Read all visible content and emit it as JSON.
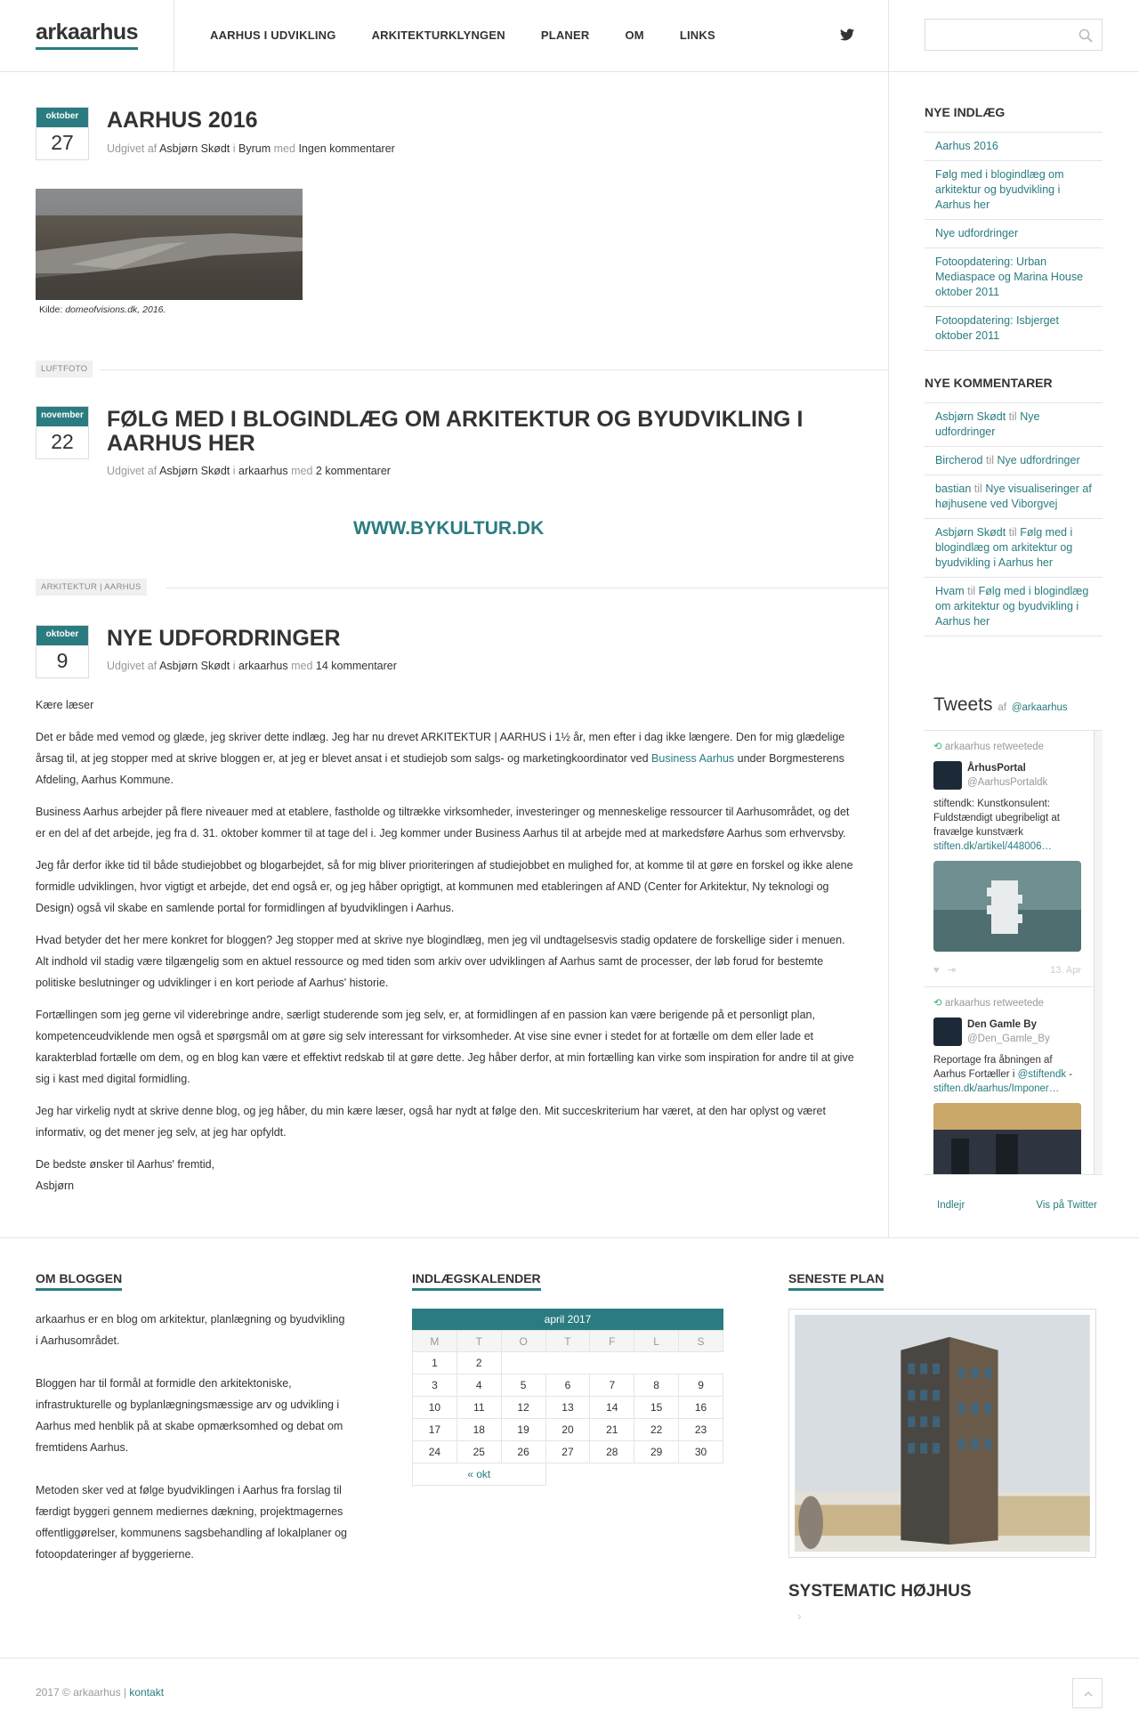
{
  "header": {
    "logo": "arkaarhus",
    "nav": [
      "AARHUS I UDVIKLING",
      "ARKITEKTURKLYNGEN",
      "PLANER",
      "OM",
      "LINKS"
    ],
    "search_placeholder": ""
  },
  "posts": [
    {
      "month": "oktober",
      "day": "27",
      "title": "AARHUS 2016",
      "meta_prefix": "Udgivet af",
      "author": "Asbjørn Skødt",
      "in": "i",
      "category": "Byrum",
      "with": "med",
      "comments": "Ingen kommentarer",
      "caption_prefix": "Kilde: ",
      "caption_source": "domeofvisions.dk, 2016."
    },
    {
      "month": "november",
      "day": "22",
      "title": "FØLG MED I BLOGINDLÆG OM ARKITEKTUR OG BYUDVIKLING I AARHUS HER",
      "meta_prefix": "Udgivet af",
      "author": "Asbjørn Skødt",
      "in": "i",
      "category": "arkaarhus",
      "with": "med",
      "comments": "2 kommentarer",
      "link": "WWW.BYKULTUR.DK"
    },
    {
      "month": "oktober",
      "day": "9",
      "title": "NYE UDFORDRINGER",
      "meta_prefix": "Udgivet af",
      "author": "Asbjørn Skødt",
      "in": "i",
      "category": "arkaarhus",
      "with": "med",
      "comments": "14 kommentarer"
    }
  ],
  "tags": [
    "LUFTFOTO",
    "ARKITEKTUR | AARHUS"
  ],
  "body": {
    "p1": "Kære læser",
    "p2a": "Det er både med vemod og glæde, jeg skriver dette indlæg. Jeg har nu drevet ARKITEKTUR | AARHUS i 1½ år, men efter i dag ikke længere. Den for mig glædelige årsag til, at jeg stopper med at skrive bloggen er, at jeg er blevet ansat i et studiejob som salgs- og marketingkoordinator ved ",
    "p2link": "Business Aarhus",
    "p2b": " under Borgmesterens Afdeling, Aarhus Kommune.",
    "p3": "Business Aarhus arbejder på flere niveauer med at etablere, fastholde og tiltrække virksomheder, investeringer og menneskelige ressourcer til Aarhusområdet, og det er en del af det arbejde, jeg fra d. 31. oktober kommer til at tage del i. Jeg kommer under Business Aarhus til at arbejde med at markedsføre Aarhus som erhvervsby.",
    "p4": "Jeg får derfor ikke tid til både studiejobbet og blogarbejdet, så for mig bliver prioriteringen af studiejobbet en mulighed for, at komme til at gøre en forskel og ikke alene formidle udviklingen, hvor vigtigt et arbejde, det end også er, og jeg håber oprigtigt, at kommunen med etableringen af AND (Center for Arkitektur, Ny teknologi og Design) også vil skabe en samlende portal for formidlingen af byudviklingen i Aarhus.",
    "p5": "Hvad betyder det her mere konkret for bloggen? Jeg stopper med at skrive nye blogindlæg, men jeg vil undtagelsesvis stadig opdatere de forskellige sider i menuen. Alt indhold vil stadig være tilgængelig som en aktuel ressource og med tiden som arkiv over udviklingen af Aarhus samt de processer, der løb forud for bestemte politiske beslutninger og udviklinger i en kort periode af Aarhus' historie.",
    "p6": "Fortællingen som jeg gerne vil viderebringe andre, særligt studerende som jeg selv, er, at formidlingen af en passion kan være berigende på et personligt plan, kompetenceudviklende men også et spørgsmål om at gøre sig selv interessant for virksomheder. At vise sine evner i stedet for at fortælle om dem eller lade et karakterblad fortælle om dem, og en blog kan være et effektivt redskab til at gøre dette. Jeg håber derfor, at min fortælling kan virke som inspiration for andre til at give sig i kast med digital formidling.",
    "p7": "Jeg har virkelig nydt at skrive denne blog, og jeg håber, du min kære læser, også har nydt at følge den. Mit succeskriterium har været, at den har oplyst og været informativ, og det mener jeg selv, at jeg har opfyldt.",
    "p8a": "De bedste ønsker til Aarhus' fremtid,",
    "p8b": "Asbjørn"
  },
  "sidebar": {
    "recent_title": "NYE INDLÆG",
    "recent": [
      "Aarhus 2016",
      "Følg med i blogindlæg om arkitektur og byudvikling i Aarhus her",
      "Nye udfordringer",
      "Fotoopdatering: Urban Mediaspace og Marina House oktober 2011",
      "Fotoopdatering: Isbjerget oktober 2011"
    ],
    "comments_title": "NYE KOMMENTARER",
    "til": "til",
    "comments": [
      {
        "who": "Asbjørn Skødt",
        "post": "Nye udfordringer"
      },
      {
        "who": "Bircherod",
        "post": "Nye udfordringer"
      },
      {
        "who": "bastian",
        "post": "Nye visualiseringer af højhusene ved Viborgvej"
      },
      {
        "who": "Asbjørn Skødt",
        "post": "Følg med i blogindlæg om arkitektur og byudvikling i Aarhus her"
      },
      {
        "who": "Hvam",
        "post": "Følg med i blogindlæg om arkitektur og byudvikling i Aarhus her"
      }
    ]
  },
  "tweets": {
    "title": "Tweets",
    "by": "af",
    "handle": "@arkaarhus",
    "items": [
      {
        "rt": "arkaarhus retweetede",
        "name": "ÅrhusPortal",
        "handle": "@AarhusPortaldk",
        "text": "stiftendk: Kunstkonsulent: Fuldstændigt ubegribeligt at fravælge kunstværk",
        "link": "stiften.dk/artikel/448006…",
        "date": "13. Apr"
      },
      {
        "rt": "arkaarhus retweetede",
        "name": "Den Gamle By",
        "handle": "@Den_Gamle_By",
        "text": "Reportage fra åbningen af Aarhus Fortæller i ",
        "mention": "@stiftendk",
        "tail": " - ",
        "link": "stiften.dk/aarhus/Imponer…"
      }
    ],
    "embed": "Indlejr",
    "view": "Vis på Twitter"
  },
  "footer": {
    "about_title": "OM BLOGGEN",
    "about": [
      "arkaarhus er en blog om arkitektur, planlægning og byudvikling i Aarhusområdet.",
      "Bloggen har til formål at formidle den arkitektoniske, infrastrukturelle og byplanlægningsmæssige arv og udvikling i Aarhus med henblik på at skabe opmærksomhed og debat om fremtidens Aarhus.",
      "Metoden sker ved at følge byudviklingen i Aarhus fra forslag til færdigt byggeri gennem mediernes dækning, projektmagernes offentliggørelser, kommunens sagsbehandling af lokalplaner og fotoopdateringer af byggerierne."
    ],
    "calendar_title": "INDLÆGSKALENDER",
    "calendar": {
      "month": "april 2017",
      "weekdays": [
        "M",
        "T",
        "O",
        "T",
        "F",
        "L",
        "S"
      ],
      "weeks": [
        [
          "1",
          "2",
          "",
          "",
          "",
          "",
          ""
        ],
        [
          "3",
          "4",
          "5",
          "6",
          "7",
          "8",
          "9"
        ],
        [
          "10",
          "11",
          "12",
          "13",
          "14",
          "15",
          "16"
        ],
        [
          "17",
          "18",
          "19",
          "20",
          "21",
          "22",
          "23"
        ],
        [
          "24",
          "25",
          "26",
          "27",
          "28",
          "29",
          "30"
        ]
      ],
      "prev": "« okt"
    },
    "plan_title": "SENESTE PLAN",
    "plan_name": "SYSTEMATIC HØJHUS",
    "copyright": "2017 © arkaarhus |",
    "contact": "kontakt"
  },
  "colors": {
    "accent": "#2a7c80"
  }
}
